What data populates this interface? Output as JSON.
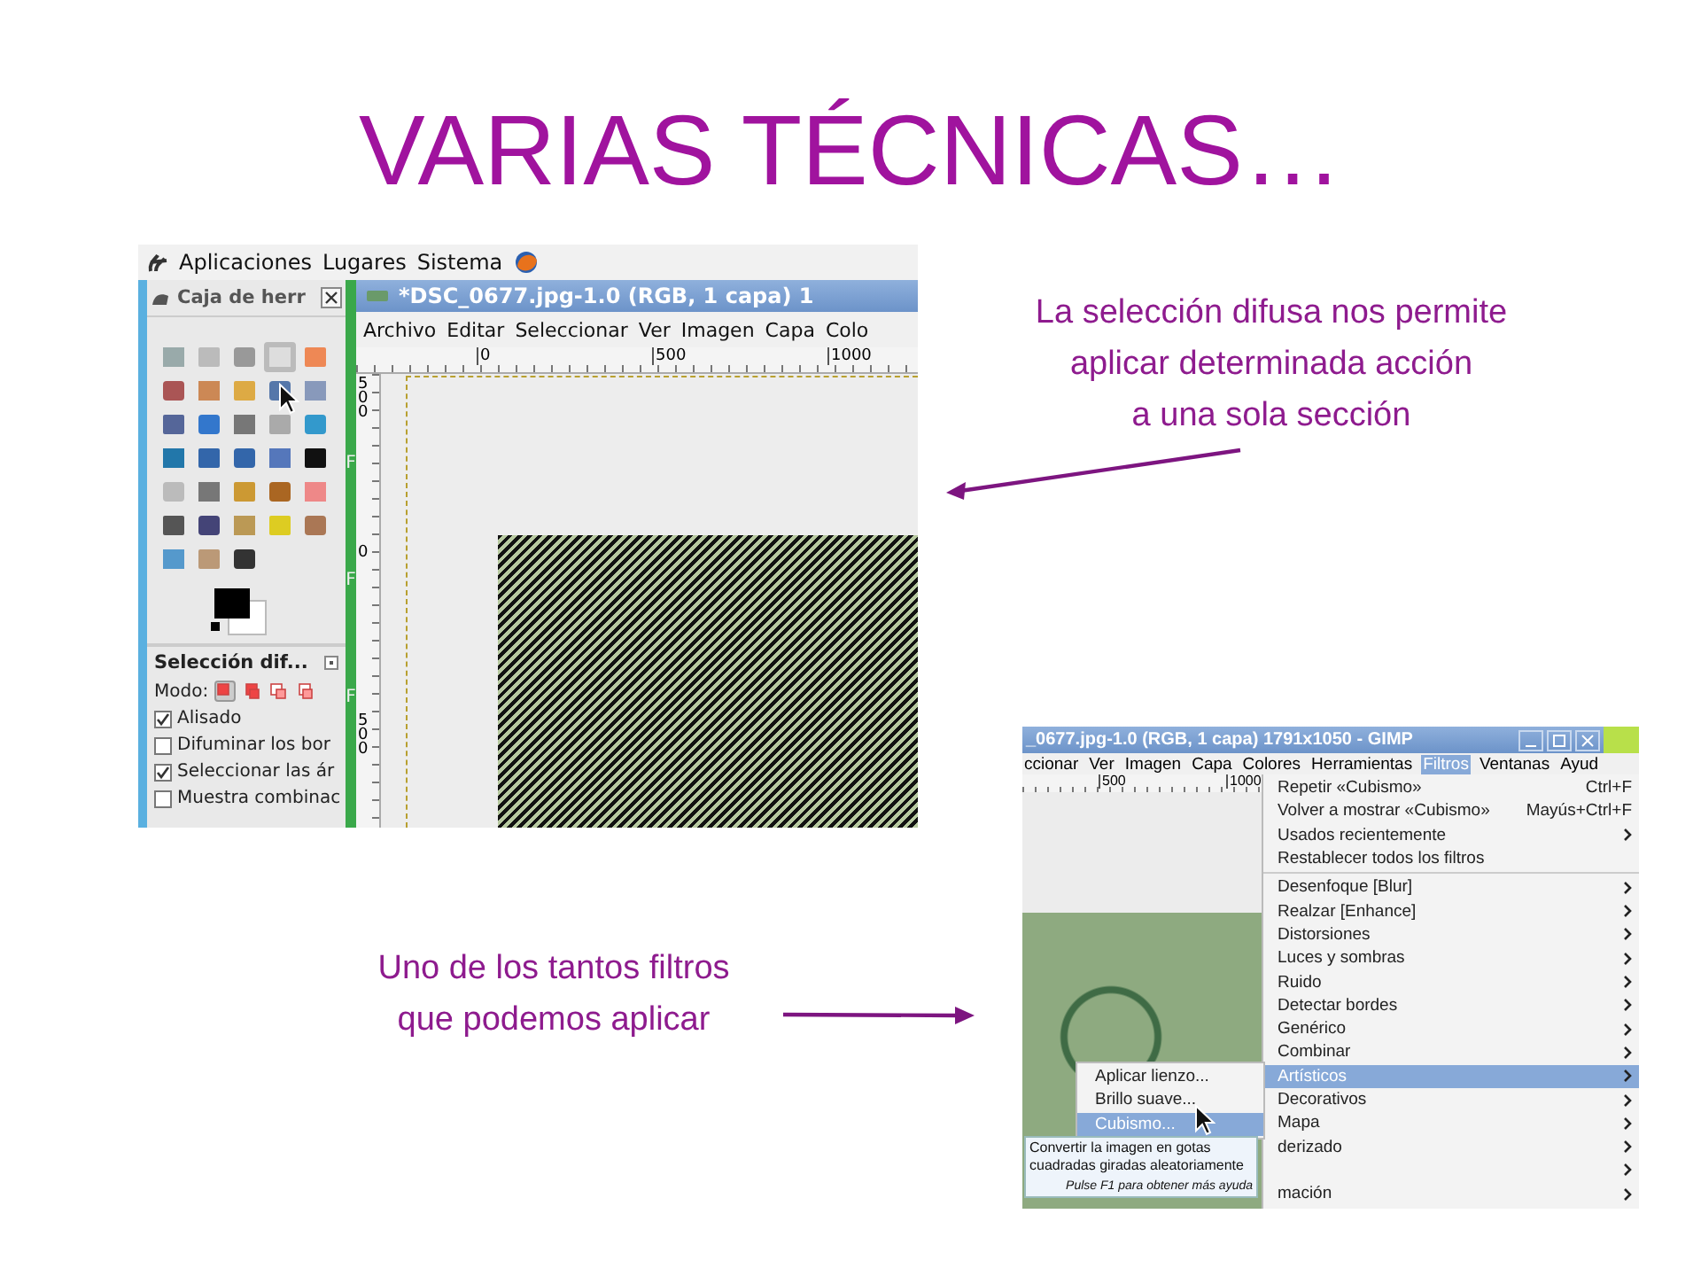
{
  "slide": {
    "title": "VARIAS TÉCNICAS…"
  },
  "screenshot_left": {
    "top_panel": {
      "menus": [
        "Aplicaciones",
        "Lugares",
        "Sistema"
      ]
    },
    "toolbox": {
      "title": "Caja de herr",
      "options_title": "Selección dif...",
      "mode_label": "Modo:",
      "modes": [
        {
          "selected": true
        },
        {
          "selected": false
        },
        {
          "selected": false
        },
        {
          "selected": false
        }
      ],
      "options": [
        {
          "label": "Alisado",
          "checked": true
        },
        {
          "label": "Difuminar los bor",
          "checked": false
        },
        {
          "label": "Seleccionar las ár",
          "checked": true
        },
        {
          "label": "Muestra combinac",
          "checked": false
        }
      ]
    },
    "background_window_letters": [
      "F",
      "F",
      "F"
    ],
    "image_window": {
      "title": "*DSC_0677.jpg-1.0 (RGB, 1 capa) 1",
      "menus": [
        "Archivo",
        "Editar",
        "Seleccionar",
        "Ver",
        "Imagen",
        "Capa",
        "Colo"
      ],
      "ruler_marks": [
        "0",
        "500",
        "1000"
      ],
      "vertical_ruler_marks": [
        "500",
        "0",
        "500"
      ]
    }
  },
  "callout_top": {
    "lines": [
      "La selección difusa nos permite",
      "aplicar determinada acción",
      "a una sola sección"
    ]
  },
  "callout_bottom": {
    "lines": [
      "Uno de los tantos filtros",
      "que podemos aplicar"
    ]
  },
  "screenshot_right": {
    "title": "_0677.jpg-1.0 (RGB, 1 capa) 1791x1050 - GIMP",
    "menus": [
      {
        "label": "ccionar",
        "selected": false
      },
      {
        "label": "Ver",
        "selected": false
      },
      {
        "label": "Imagen",
        "selected": false
      },
      {
        "label": "Capa",
        "selected": false
      },
      {
        "label": "Colores",
        "selected": false
      },
      {
        "label": "Herramientas",
        "selected": false
      },
      {
        "label": "Filtros",
        "selected": true
      },
      {
        "label": "Ventanas",
        "selected": false
      },
      {
        "label": "Ayud",
        "selected": false
      }
    ],
    "ruler_marks": [
      "500",
      "1000"
    ],
    "filters_menu": [
      [
        {
          "label": "Repetir «Cubismo»",
          "shortcut": "Ctrl+F",
          "submenu": false,
          "selected": false
        },
        {
          "label": "Volver a mostrar «Cubismo»",
          "shortcut": "Mayús+Ctrl+F",
          "submenu": false,
          "selected": false
        },
        {
          "label": "Usados recientemente",
          "submenu": true,
          "selected": false
        },
        {
          "label": "Restablecer todos los filtros",
          "submenu": false,
          "selected": false
        }
      ],
      [
        {
          "label": "Desenfoque [Blur]",
          "submenu": true,
          "selected": false
        },
        {
          "label": "Realzar [Enhance]",
          "submenu": true,
          "selected": false
        },
        {
          "label": "Distorsiones",
          "submenu": true,
          "selected": false
        },
        {
          "label": "Luces y sombras",
          "submenu": true,
          "selected": false
        },
        {
          "label": "Ruido",
          "submenu": true,
          "selected": false
        },
        {
          "label": "Detectar bordes",
          "submenu": true,
          "selected": false
        },
        {
          "label": "Genérico",
          "submenu": true,
          "selected": false
        },
        {
          "label": "Combinar",
          "submenu": true,
          "selected": false
        },
        {
          "label": "Artísticos",
          "submenu": true,
          "selected": true
        },
        {
          "label": "Decorativos",
          "submenu": true,
          "selected": false
        },
        {
          "label": "Mapa",
          "submenu": true,
          "selected": false
        },
        {
          "label": "derizado",
          "submenu": true,
          "selected": false
        },
        {
          "submenu": true,
          "selected": false
        },
        {
          "label": "mación",
          "submenu": true,
          "selected": false
        }
      ]
    ],
    "submenu": [
      {
        "label": "Aplicar lienzo...",
        "selected": false
      },
      {
        "label": "Brillo suave...",
        "selected": false
      },
      {
        "label": "Cubismo...",
        "selected": true
      }
    ],
    "tooltip": {
      "lines": [
        "Convertir la imagen en gotas",
        "cuadradas giradas aleatoriamente"
      ],
      "hint": "Pulse F1 para obtener más ayuda"
    }
  }
}
